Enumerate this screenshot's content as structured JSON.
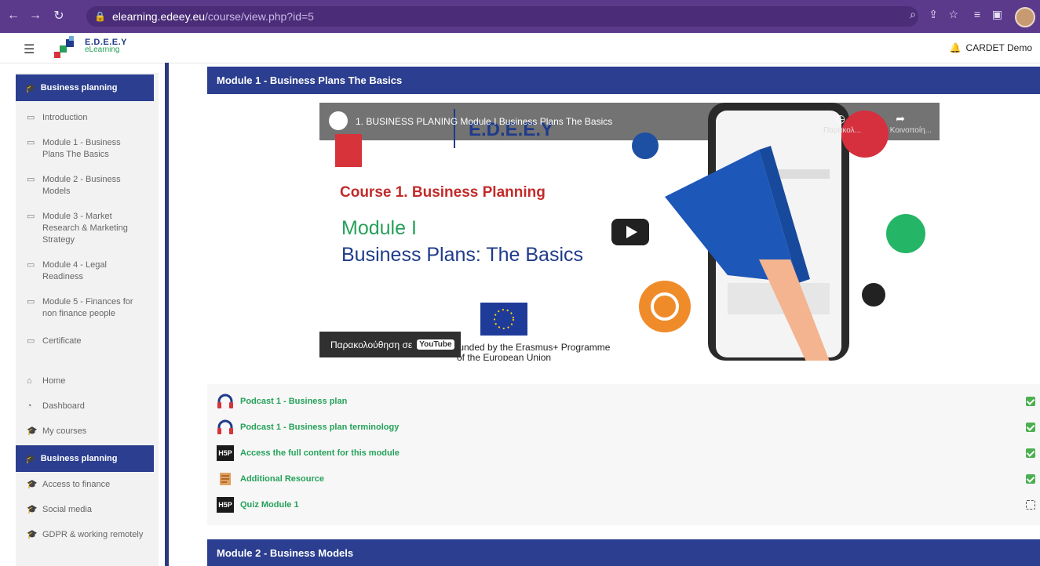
{
  "browser": {
    "url_host": "elearning.edeey.eu",
    "url_path": "/course/view.php?id=5"
  },
  "header": {
    "logo_line1": "E.D.E.E.Y",
    "logo_line2": "eLearning",
    "user_name": "CARDET Demo"
  },
  "sidebar": {
    "course_title": "Business planning",
    "sections": [
      {
        "label": "Introduction"
      },
      {
        "label": "Module 1 - Business Plans The Basics"
      },
      {
        "label": "Module 2 - Business Models"
      },
      {
        "label": "Module 3 - Market Research & Marketing Strategy"
      },
      {
        "label": "Module 4 - Legal Readiness"
      },
      {
        "label": "Module 5 - Finances for non finance people"
      },
      {
        "label": "Certificate"
      }
    ],
    "nav": [
      {
        "label": "Home"
      },
      {
        "label": "Dashboard"
      },
      {
        "label": "My courses"
      }
    ],
    "active_course": "Business planning",
    "courses": [
      {
        "label": "Access to finance"
      },
      {
        "label": "Social media"
      },
      {
        "label": "GDPR & working remotely"
      }
    ]
  },
  "main": {
    "module1_title": "Module 1 - Business Plans The Basics",
    "video": {
      "title": "1. BUSINESS PLANING Module I Business Plans The Basics",
      "brand": "E.D.E.E.Y",
      "course_line": "Course 1. Business Planning",
      "module_line": "Module I",
      "module_subtitle": "Business Plans: The Basics",
      "erasmus_line1": "Funded by the Erasmus+ Programme",
      "erasmus_line2": "of the European Union",
      "watch_later": "Παρακολ...",
      "share": "Κοινοποίη...",
      "watch_on": "Παρακολούθηση σε",
      "youtube": "YouTube"
    },
    "activities": [
      {
        "label": "Podcast 1 - Business plan",
        "icon": "headphones-icon",
        "done": true
      },
      {
        "label": "Podcast 1 - Business plan terminology",
        "icon": "headphones-icon",
        "done": true
      },
      {
        "label": "Access the full content for this module",
        "icon": "h5p-icon",
        "done": true
      },
      {
        "label": "Additional Resource",
        "icon": "resource-icon",
        "done": true
      },
      {
        "label": "Quiz Module 1",
        "icon": "h5p-icon",
        "done": false
      }
    ],
    "h5p_label": "H5P",
    "module2_title": "Module 2 - Business Models"
  },
  "colors": {
    "primary": "#2b3e8f",
    "accent_green": "#25a25a",
    "browser": "#5b3a8c"
  }
}
